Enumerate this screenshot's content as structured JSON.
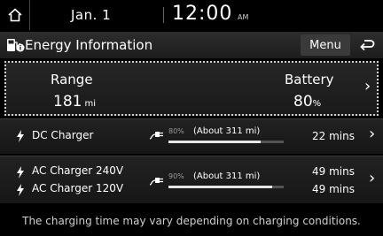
{
  "status": {
    "date": "Jan.  1",
    "time": "12:00",
    "ampm": "AM"
  },
  "header": {
    "title": "Energy Information",
    "menu_label": "Menu"
  },
  "summary": {
    "range_label": "Range",
    "range_value": "181",
    "range_unit": "mi",
    "battery_label": "Battery",
    "battery_value": "80",
    "battery_unit": "%"
  },
  "dc": {
    "label": "DC Charger",
    "percent": "80%",
    "about": "(About 311 mi)",
    "progress": 0.8,
    "time": "22 mins"
  },
  "ac": {
    "label_240": "AC Charger 240V",
    "label_120": "AC Charger 120V",
    "percent": "90%",
    "about": "(About 311 mi)",
    "progress": 0.9,
    "time_240": "49 mins",
    "time_120": "49 mins"
  },
  "footer": {
    "note": "The charging time may vary depending on charging conditions."
  }
}
